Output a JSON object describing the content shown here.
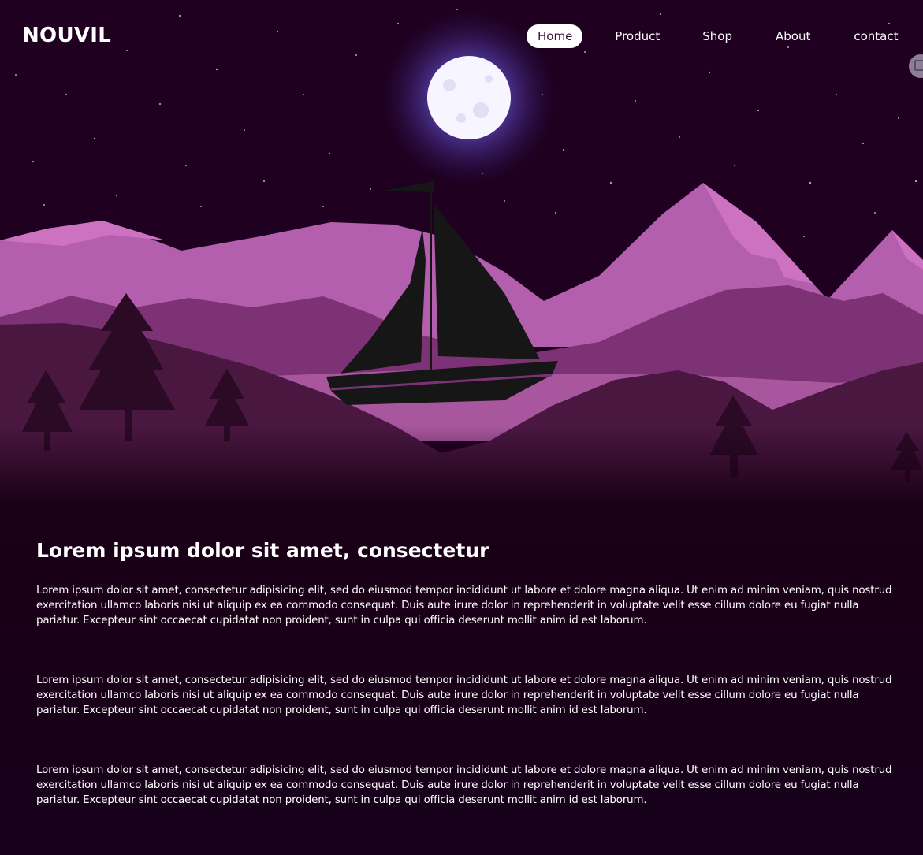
{
  "header": {
    "logo": "NOUVIL",
    "nav": [
      {
        "label": "Home",
        "active": true
      },
      {
        "label": "Product",
        "active": false
      },
      {
        "label": "Shop",
        "active": false
      },
      {
        "label": "About",
        "active": false
      },
      {
        "label": "contact",
        "active": false
      }
    ]
  },
  "main": {
    "heading": "Lorem ipsum dolor sit amet, consectetur",
    "paragraphs": [
      "Lorem ipsum dolor sit amet, consectetur adipisicing elit, sed do eiusmod tempor incididunt ut labore et dolore magna aliqua. Ut enim ad minim veniam, quis nostrud exercitation ullamco laboris nisi ut aliquip ex ea commodo consequat. Duis aute irure dolor in reprehenderit in voluptate velit esse cillum dolore eu fugiat nulla pariatur. Excepteur sint occaecat cupidatat non proident, sunt in culpa qui officia deserunt mollit anim id est laborum.",
      "Lorem ipsum dolor sit amet, consectetur adipisicing elit, sed do eiusmod tempor incididunt ut labore et dolore magna aliqua. Ut enim ad minim veniam, quis nostrud exercitation ullamco laboris nisi ut aliquip ex ea commodo consequat. Duis aute irure dolor in reprehenderit in voluptate velit esse cillum dolore eu fugiat nulla pariatur. Excepteur sint occaecat cupidatat non proident, sunt in culpa qui officia deserunt mollit anim id est laborum.",
      "Lorem ipsum dolor sit amet, consectetur adipisicing elit, sed do eiusmod tempor incididunt ut labore et dolore magna aliqua. Ut enim ad minim veniam, quis nostrud exercitation ullamco laboris nisi ut aliquip ex ea commodo consequat. Duis aute irure dolor in reprehenderit in voluptate velit esse cillum dolore eu fugiat nulla pariatur. Excepteur sint occaecat cupidatat non proident, sunt in culpa qui officia deserunt mollit anim id est laborum."
    ]
  },
  "colors": {
    "background": "#1b0016",
    "sky": "#1e0020",
    "mountain_light": "#b45fad",
    "mountain_highlight": "#cd72c0",
    "mountain_mid": "#7c3275",
    "hill_dark": "#4a1741",
    "lake": "#a8579f",
    "boat": "#161616",
    "moon": "#f7f5ff",
    "moon_glow": "#7d6cf2",
    "nav_active_bg": "#ffffff",
    "nav_active_text": "#3a1436",
    "text": "#ffffff"
  },
  "icons": {
    "side_handle": "scan-icon"
  }
}
